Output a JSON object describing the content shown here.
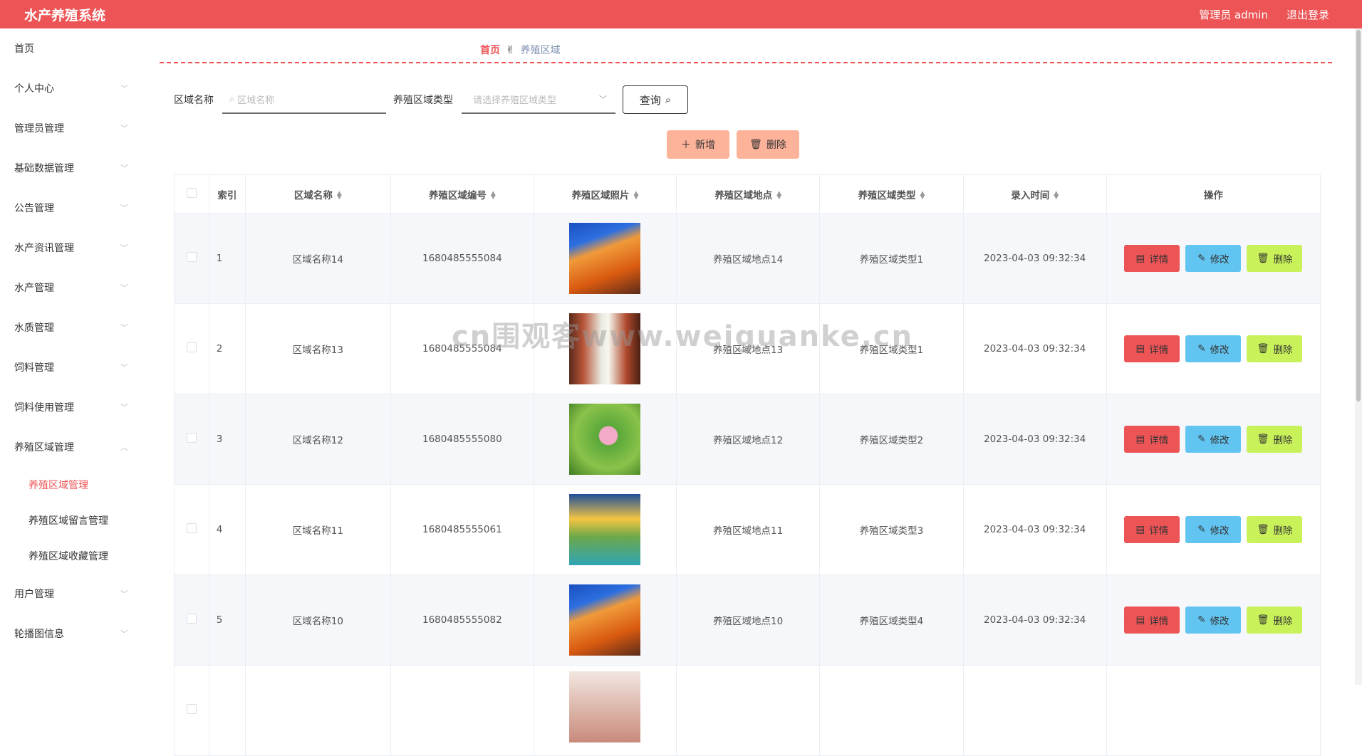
{
  "header": {
    "title": "水产养殖系统",
    "user": "管理员 admin",
    "logout": "退出登录"
  },
  "sidebar": {
    "items": [
      {
        "label": "首页"
      },
      {
        "label": "个人中心"
      },
      {
        "label": "管理员管理"
      },
      {
        "label": "基础数据管理"
      },
      {
        "label": "公告管理"
      },
      {
        "label": "水产资讯管理"
      },
      {
        "label": "水产管理"
      },
      {
        "label": "水质管理"
      },
      {
        "label": "饲料管理"
      },
      {
        "label": "饲料使用管理"
      },
      {
        "label": "养殖区域管理"
      },
      {
        "label": "用户管理"
      },
      {
        "label": "轮播图信息"
      }
    ],
    "subitems": [
      {
        "label": "养殖区域管理"
      },
      {
        "label": "养殖区域留言管理"
      },
      {
        "label": "养殖区域收藏管理"
      }
    ]
  },
  "breadcrumb": {
    "home": "首页",
    "current": "养殖区域"
  },
  "search": {
    "name_label": "区域名称",
    "name_placeholder": "区域名称",
    "type_label": "养殖区域类型",
    "type_placeholder": "请选择养殖区域类型",
    "query_button": "查询"
  },
  "toolbar": {
    "add": "新增",
    "delete": "删除"
  },
  "table": {
    "headers": [
      "索引",
      "区域名称",
      "养殖区域编号",
      "养殖区域照片",
      "养殖区域地点",
      "养殖区域类型",
      "录入时间",
      "操作"
    ],
    "rows": [
      {
        "index": "1",
        "name": "区域名称14",
        "code": "1680485555084",
        "location": "养殖区域地点14",
        "type": "养殖区域类型1",
        "time": "2023-04-03 09:32:34"
      },
      {
        "index": "2",
        "name": "区域名称13",
        "code": "1680485555084",
        "location": "养殖区域地点13",
        "type": "养殖区域类型1",
        "time": "2023-04-03 09:32:34"
      },
      {
        "index": "3",
        "name": "区域名称12",
        "code": "1680485555080",
        "location": "养殖区域地点12",
        "type": "养殖区域类型2",
        "time": "2023-04-03 09:32:34"
      },
      {
        "index": "4",
        "name": "区域名称11",
        "code": "1680485555061",
        "location": "养殖区域地点11",
        "type": "养殖区域类型3",
        "time": "2023-04-03 09:32:34"
      },
      {
        "index": "5",
        "name": "区域名称10",
        "code": "1680485555082",
        "location": "养殖区域地点10",
        "type": "养殖区域类型4",
        "time": "2023-04-03 09:32:34"
      }
    ],
    "row_actions": {
      "detail": "详情",
      "edit": "修改",
      "delete": "删除"
    }
  },
  "watermark": "cn围观客www.weiguanke.cn"
}
